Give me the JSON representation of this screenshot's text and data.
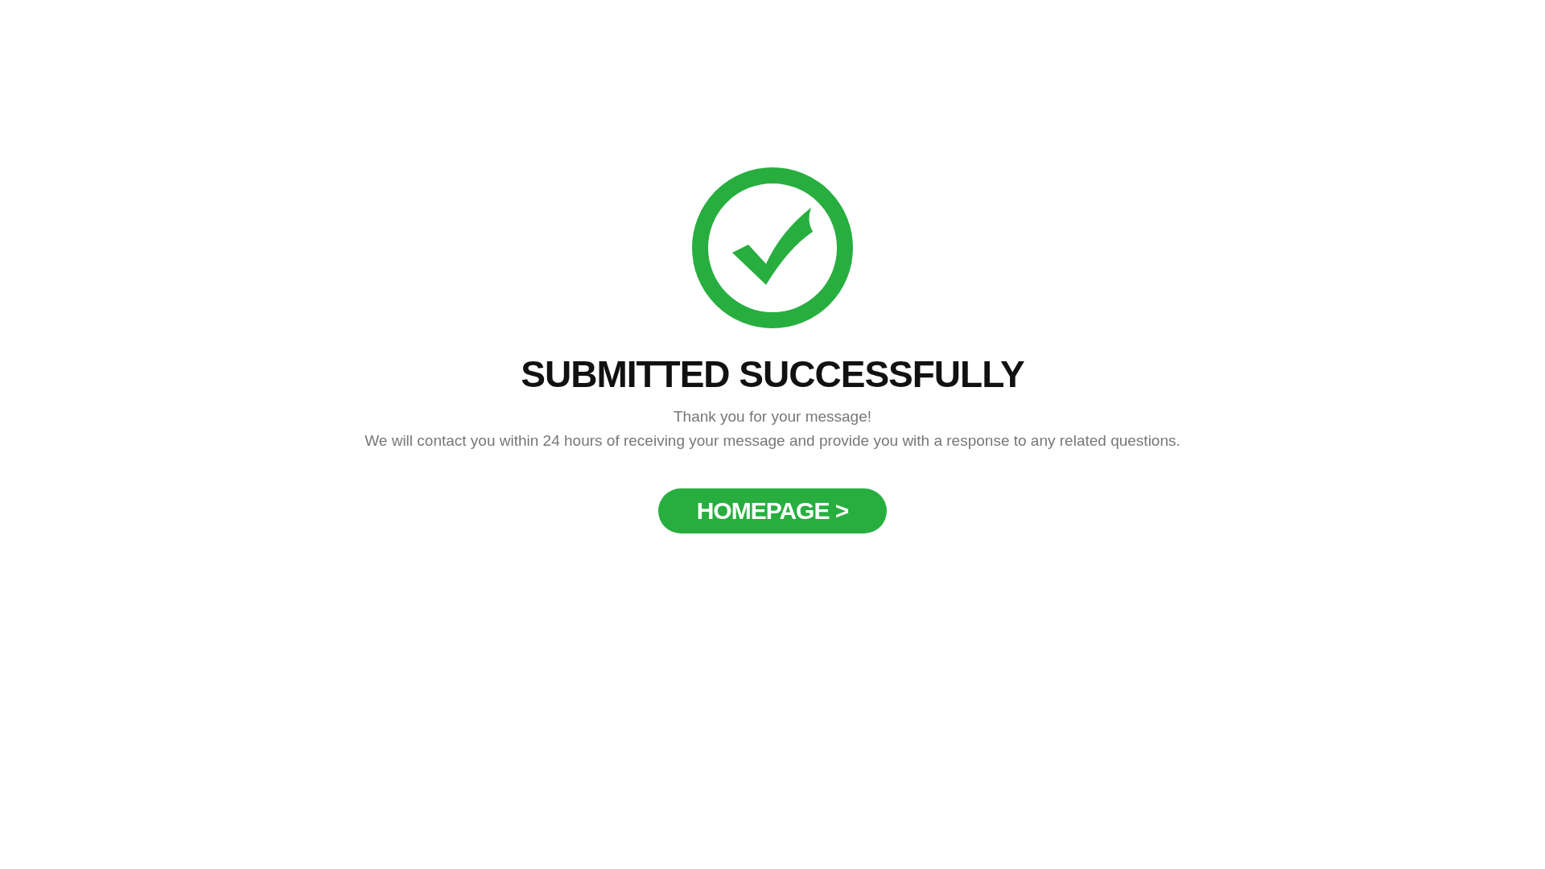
{
  "title": "SUBMITTED SUCCESSFULLY",
  "messages": [
    "Thank you for your message!",
    "We will contact you within 24 hours of receiving your message and provide you with a response to any related questions."
  ],
  "button": {
    "label": "HOMEPAGE >"
  }
}
